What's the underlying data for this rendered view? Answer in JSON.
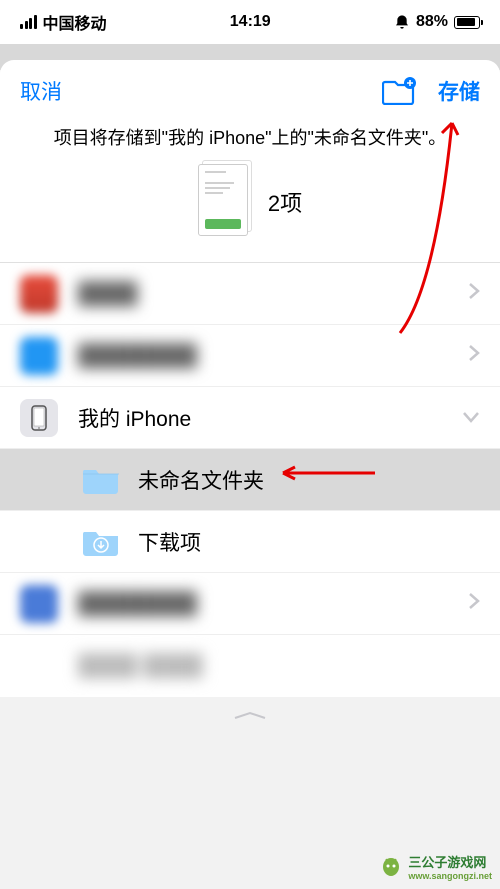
{
  "status_bar": {
    "carrier": "中国移动",
    "time": "14:19",
    "battery_pct": "88%"
  },
  "header": {
    "cancel": "取消",
    "save": "存储"
  },
  "prompt": "项目将存储到\"我的 iPhone\"上的\"未命名文件夹\"。",
  "preview": {
    "count": "2项"
  },
  "locations": {
    "item3_label": "我的 iPhone",
    "subfolder1": "未命名文件夹",
    "subfolder2": "下载项"
  },
  "watermark": {
    "text": "三公子游戏网",
    "url": "www.sangongzi.net"
  }
}
